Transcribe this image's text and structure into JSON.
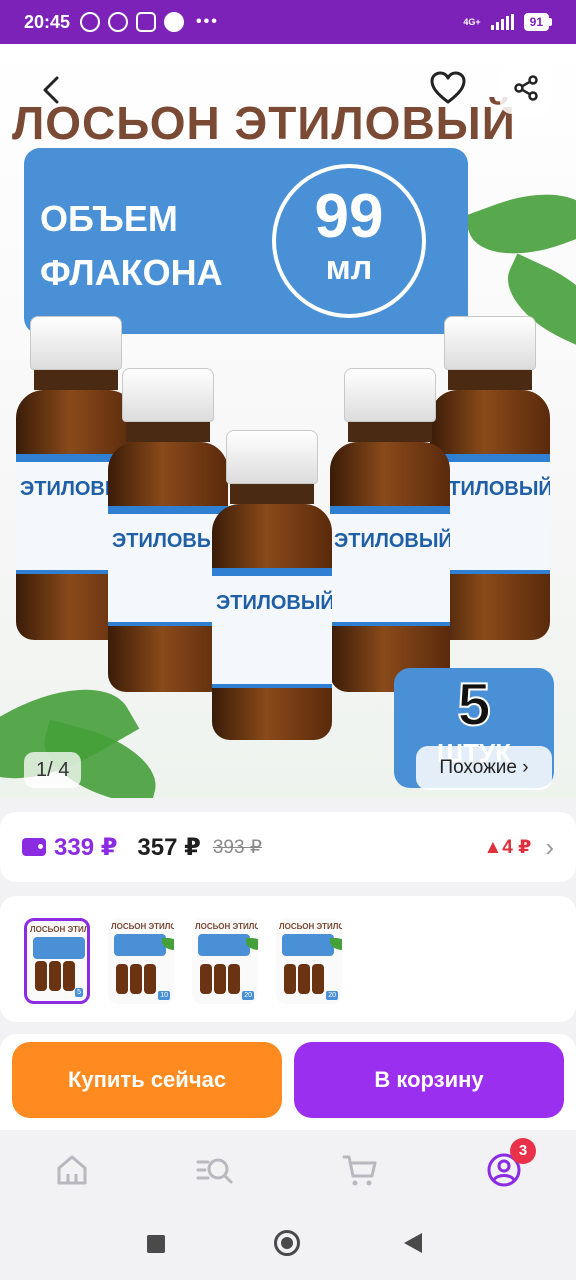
{
  "status_bar": {
    "time": "20:45",
    "network": "4G+",
    "battery": "91"
  },
  "product_image": {
    "title": "ЛОСЬОН ЭТИЛОВЫЙ",
    "volume_line1": "ОБЪЕМ",
    "volume_line2": "ФЛАКОНА",
    "volume_value": "99",
    "volume_unit": "мл",
    "bottle_label": "ЭТИЛОВЫЙ",
    "quantity_value": "5",
    "quantity_word": "ШТУК"
  },
  "gallery": {
    "page_indicator": "1/ 4",
    "similar_label": "Похожие ›",
    "thumbnails": [
      {
        "title": "ЛОСЬОН ЭТИЛОВЫЙ",
        "count": "5",
        "selected": true
      },
      {
        "title": "ЛОСЬОН ЭТИЛОВЫЙ",
        "count": "10",
        "selected": false
      },
      {
        "title": "ЛОСЬОН ЭТИЛОВЫЙ",
        "count": "20",
        "selected": false
      },
      {
        "title": "ЛОСЬОН ЭТИЛОВЫЙ",
        "count": "20",
        "selected": false
      }
    ]
  },
  "price": {
    "wallet_price": "339 ₽",
    "current_price": "357 ₽",
    "old_price": "393 ₽",
    "change": "▲4 ₽"
  },
  "actions": {
    "buy_now": "Купить сейчас",
    "add_to_cart": "В корзину"
  },
  "bottom_nav": {
    "cart_badge": "3",
    "items": [
      "home-icon",
      "catalog-search-icon",
      "cart-icon",
      "profile-icon"
    ]
  },
  "colors": {
    "brand_purple": "#8b2be2",
    "buy_orange": "#ff8a1f",
    "cart_purple": "#9b2ff0",
    "banner_blue": "#4a90d6",
    "price_up_red": "#e0303d"
  }
}
